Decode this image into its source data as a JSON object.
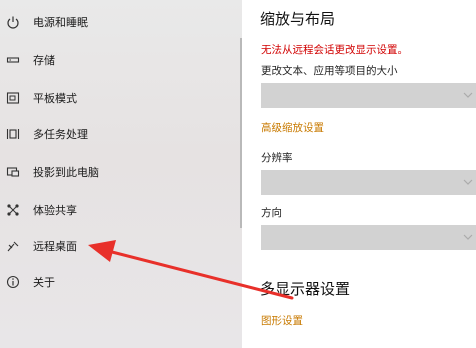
{
  "sidebar": {
    "items": [
      {
        "label": "电源和睡眠",
        "icon": "power-icon"
      },
      {
        "label": "存储",
        "icon": "storage-icon"
      },
      {
        "label": "平板模式",
        "icon": "tablet-mode-icon"
      },
      {
        "label": "多任务处理",
        "icon": "multitasking-icon"
      },
      {
        "label": "投影到此电脑",
        "icon": "project-icon"
      },
      {
        "label": "体验共享",
        "icon": "shared-experience-icon"
      },
      {
        "label": "远程桌面",
        "icon": "remote-desktop-icon"
      },
      {
        "label": "关于",
        "icon": "info-icon"
      }
    ]
  },
  "main": {
    "title": "缩放与布局",
    "warning": "无法从远程会话更改显示设置。",
    "scale_label": "更改文本、应用等项目的大小",
    "scale_value": "",
    "advanced_scaling_link": "高级缩放设置",
    "resolution_label": "分辨率",
    "resolution_value": "",
    "orientation_label": "方向",
    "orientation_value": "",
    "multi_display_title": "多显示器设置",
    "graphics_settings_link": "图形设置"
  },
  "colors": {
    "warning": "#d10000",
    "link": "#c87a00",
    "annotation_arrow": "#e8302a"
  }
}
